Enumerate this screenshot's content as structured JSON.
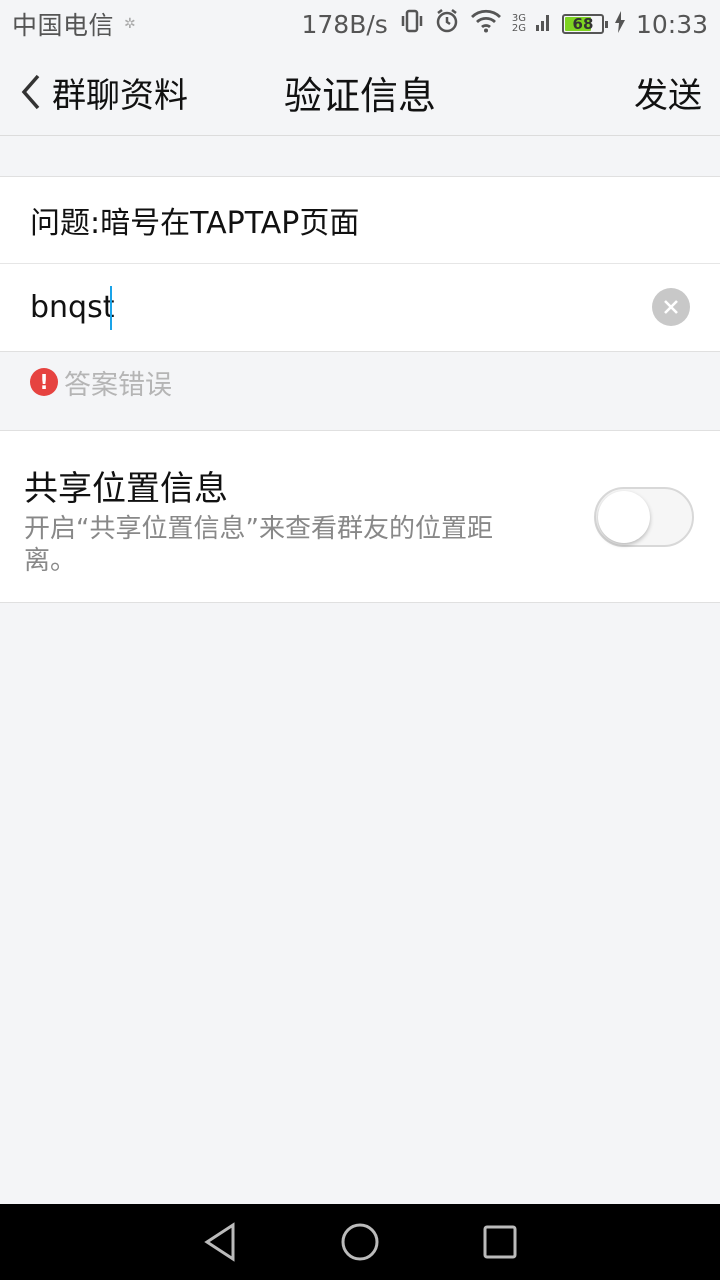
{
  "status_bar": {
    "carrier": "中国电信",
    "net_speed": "178B/s",
    "network_type_top": "3G",
    "network_type_bottom": "2G",
    "battery_level": "68",
    "time": "10:33"
  },
  "header": {
    "back_label": "群聊资料",
    "title": "验证信息",
    "send_label": "发送"
  },
  "question": {
    "text": "问题:暗号在TAPTAP页面"
  },
  "answer": {
    "value": "bnqst"
  },
  "error": {
    "icon_text": "!",
    "message": "答案错误"
  },
  "share_location": {
    "title": "共享位置信息",
    "description": "开启“共享位置信息”来查看群友的位置距离。",
    "enabled": false
  },
  "colors": {
    "background": "#f4f5f7",
    "error_red": "#e64340",
    "cursor_blue": "#1aa3e8",
    "battery_green": "#7ed321"
  }
}
